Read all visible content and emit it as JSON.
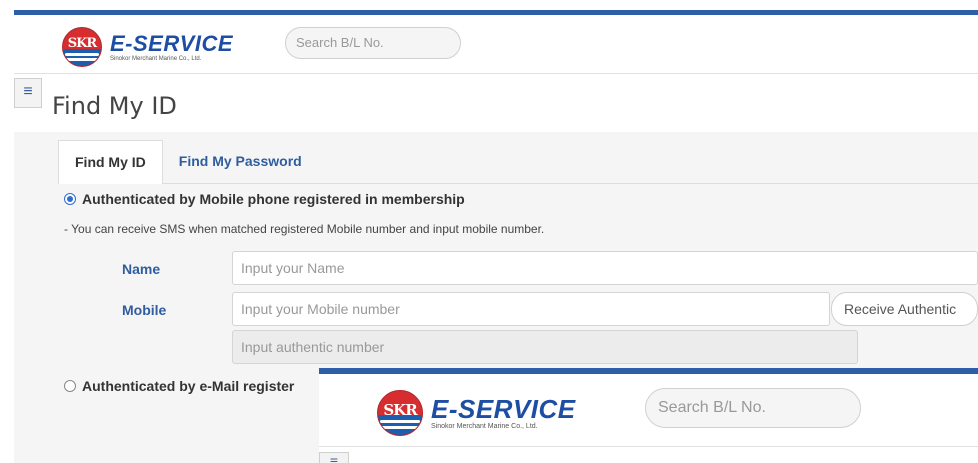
{
  "header": {
    "logo_title": "E-SERVICE",
    "logo_sub": "Sinokor Merchant Marine Co., Ltd.",
    "logo_badge": "SKR",
    "search_placeholder": "Search B/L No."
  },
  "menu_icon": "≡",
  "page_title": "Find My ID",
  "tabs": [
    {
      "label": "Find My ID",
      "active": true
    },
    {
      "label": "Find My Password",
      "active": false
    }
  ],
  "option_mobile": {
    "label": "Authenticated by Mobile phone registered in membership",
    "checked": true,
    "note": "- You can receive SMS when matched registered Mobile number and input mobile number."
  },
  "form": {
    "name_label": "Name",
    "name_placeholder": "Input your Name",
    "mobile_label": "Mobile",
    "mobile_placeholder": "Input your Mobile number",
    "receive_button": "Receive Authentic",
    "auth_placeholder": "Input authentic number"
  },
  "option_email": {
    "label": "Authenticated by e-Mail register",
    "checked": false
  },
  "colors": {
    "brand_blue": "#2e5ea8",
    "link_blue": "#2f5d9e",
    "logo_red": "#d82d2f"
  }
}
